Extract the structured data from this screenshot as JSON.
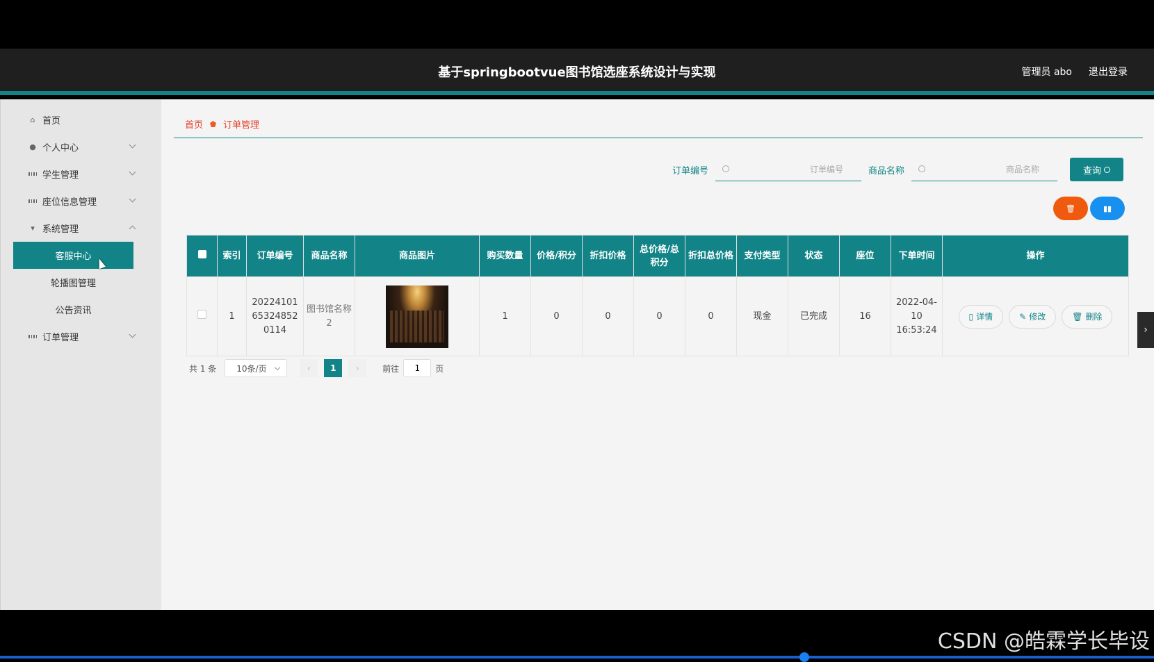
{
  "header": {
    "title": "基于springbootvue图书馆选座系统设计与实现",
    "user": "管理员 abo",
    "logout": "退出登录"
  },
  "sidebar": {
    "home": "首页",
    "personal": "个人中心",
    "students": "学生管理",
    "seats": "座位信息管理",
    "system": "系统管理",
    "system_sub": [
      "客服中心",
      "轮播图管理",
      "公告资讯"
    ],
    "orders": "订单管理"
  },
  "breadcrumb": {
    "home": "首页",
    "current": "订单管理"
  },
  "search": {
    "order_label": "订单编号",
    "order_placeholder": "订单编号",
    "goods_label": "商品名称",
    "goods_placeholder": "商品名称",
    "query": "查询"
  },
  "table": {
    "headers": [
      "索引",
      "订单编号",
      "商品名称",
      "商品图片",
      "购买数量",
      "价格/积分",
      "折扣价格",
      "总价格/总积分",
      "折扣总价格",
      "支付类型",
      "状态",
      "座位",
      "下单时间",
      "操作"
    ],
    "row": {
      "index": "1",
      "order_no": "20224101 65324852 0114",
      "goods": "图书馆名称2",
      "qty": "1",
      "price": "0",
      "discount_price": "0",
      "total": "0",
      "discount_total": "0",
      "pay_type": "现金",
      "status": "已完成",
      "seat": "16",
      "time": "2022-04-10 16:53:24"
    },
    "ops": {
      "detail": "详情",
      "edit": "修改",
      "delete": "删除"
    }
  },
  "pager": {
    "total": "共 1 条",
    "size": "10条/页",
    "current": "1",
    "goto_prefix": "前往",
    "goto_value": "1",
    "goto_suffix": "页"
  },
  "watermark": "CSDN @皓霖学长毕设",
  "colors": {
    "primary": "#128487",
    "danger": "#f05a0e",
    "info": "#1790f0"
  }
}
